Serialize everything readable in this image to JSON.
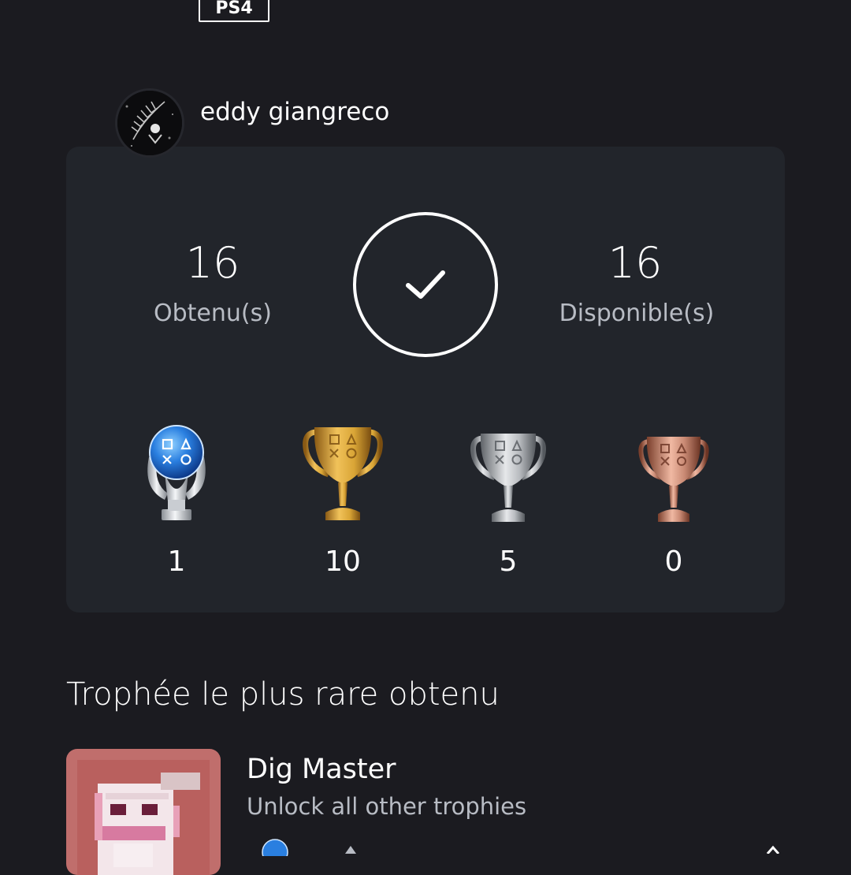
{
  "platform": "PS4",
  "user": {
    "name": "eddy giangreco"
  },
  "summary": {
    "earned_value": "16",
    "earned_label": "Obtenu(s)",
    "available_value": "16",
    "available_label": "Disponible(s)",
    "completed": true
  },
  "trophies": [
    {
      "type": "platinum",
      "icon": "platinum-trophy-icon",
      "count": "1"
    },
    {
      "type": "gold",
      "icon": "gold-trophy-icon",
      "count": "10"
    },
    {
      "type": "silver",
      "icon": "silver-trophy-icon",
      "count": "5"
    },
    {
      "type": "bronze",
      "icon": "bronze-trophy-icon",
      "count": "0"
    }
  ],
  "rarest": {
    "section_title": "Trophée le plus rare obtenu",
    "name": "Dig Master",
    "description": "Unlock all other trophies"
  },
  "colors": {
    "background": "#1b1b20",
    "card": "#22252b",
    "text_secondary": "#b8bcc4",
    "gold": "#d9a536",
    "silver": "#b9bcc0",
    "bronze": "#c98a74",
    "platinum": "#3d8ee8"
  }
}
